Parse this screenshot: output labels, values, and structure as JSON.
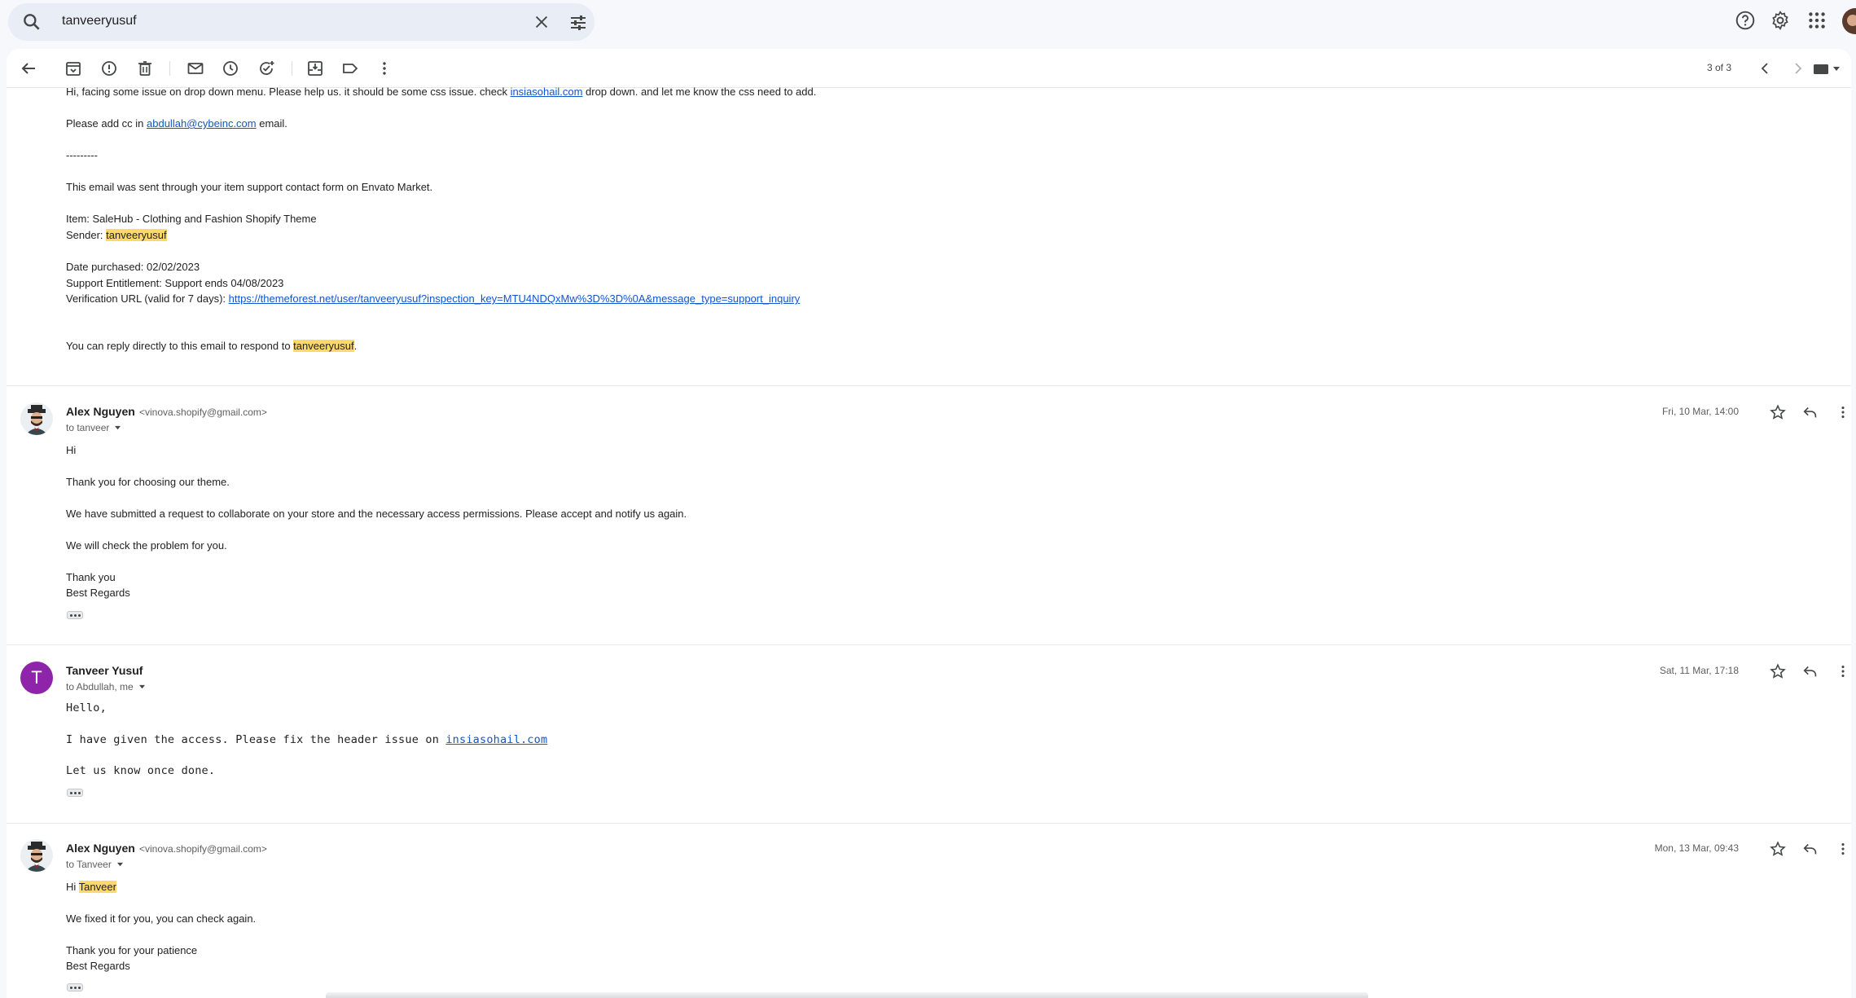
{
  "search": {
    "value": "tanveeryusuf"
  },
  "pager": {
    "text": "3 of 3"
  },
  "first_message": {
    "line1_before": "Hi, facing some issue on drop down menu. Please help us. it should be some css issue. check ",
    "line1_link": "insiasohail.com",
    "line1_after": " drop down. and let me know the css need to add.",
    "line2_before": "Please add cc in ",
    "line2_link": "abdullah@cybeinc.com",
    "line2_after": " email.",
    "separator": "---------",
    "sent_through": "This email was sent through your item support contact form on Envato Market.",
    "item": "Item: SaleHub - Clothing and Fashion Shopify Theme",
    "sender_label": "Sender: ",
    "sender_value": "tanveeryusuf",
    "date_purchased": "Date purchased: 02/02/2023",
    "support": "Support Entitlement: Support ends 04/08/2023",
    "verification_label": "Verification URL (valid for 7 days): ",
    "verification_url": "https://themeforest.net/user/tanveeryusuf?inspection_key=MTU4NDQxMw%3D%3D%0A&message_type=support_inquiry",
    "reply_before": "You can reply directly to this email to respond to ",
    "reply_name": "tanveeryusuf",
    "reply_after": "."
  },
  "messages": [
    {
      "sender": "Alex Nguyen",
      "email": "<vinova.shopify@gmail.com>",
      "to": "to tanveer",
      "date": "Fri, 10 Mar, 14:00",
      "lines": [
        "Hi",
        "Thank you for choosing our theme.",
        "We have submitted a request to collaborate on your store and the necessary access permissions. Please accept and notify us again.",
        "We will check the problem for you.",
        "Thank you",
        "Best Regards"
      ]
    },
    {
      "sender": "Tanveer Yusuf",
      "avatar_letter": "T",
      "to": "to Abdullah, me",
      "date": "Sat, 11 Mar, 17:18",
      "greeting": "Hello,",
      "access_before": "I have given the access. Please fix the header issue on ",
      "access_link": "insiasohail.com",
      "done": "Let us know once done."
    },
    {
      "sender": "Alex Nguyen",
      "email": "<vinova.shopify@gmail.com>",
      "to": "to Tanveer",
      "date": "Mon, 13 Mar, 09:43",
      "hi": "Hi ",
      "hi_name": "Tanveer",
      "lines": [
        "We fixed it for you, you can check again.",
        "Thank you for your patience",
        "Best Regards"
      ]
    }
  ],
  "colors": {
    "accent": "#1155cc",
    "highlight": "#fcd968",
    "avatar_purple": "#8e24aa"
  }
}
